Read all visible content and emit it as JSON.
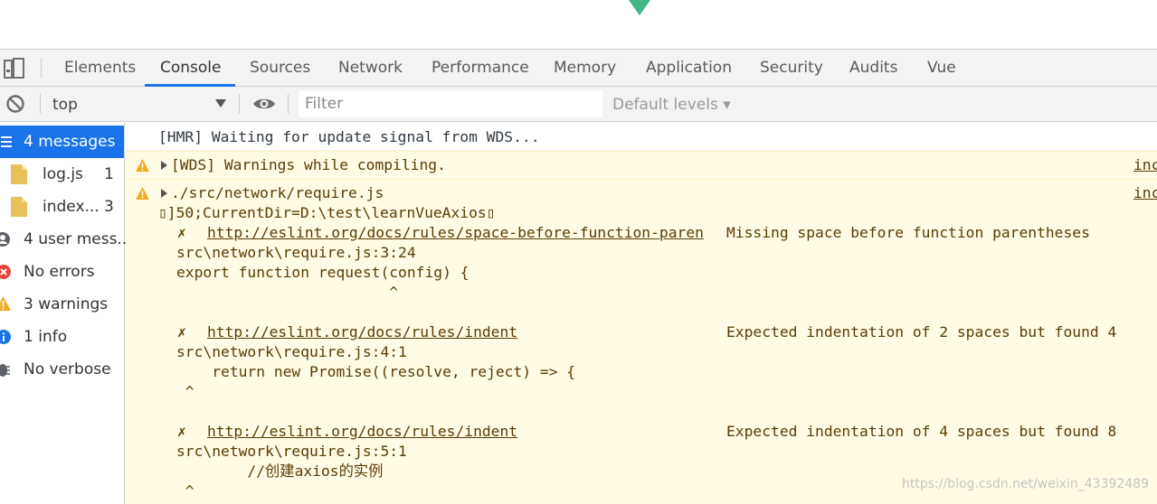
{
  "devtools": {
    "tabs": [
      "Elements",
      "Console",
      "Sources",
      "Network",
      "Performance",
      "Memory",
      "Application",
      "Security",
      "Audits",
      "Vue"
    ],
    "active_tab": "Console",
    "accent": "#1a73e8"
  },
  "toolbar": {
    "context": "top",
    "filter_placeholder": "Filter",
    "levels": "Default levels ▾"
  },
  "sidebar": {
    "messages": "4 messages",
    "files": [
      {
        "name": "log.js",
        "count": "1"
      },
      {
        "name": "index...",
        "count": "3"
      }
    ],
    "user_messages": "4 user mess...",
    "errors": "No errors",
    "warnings": "3 warnings",
    "info": "1 info",
    "verbose": "No verbose"
  },
  "console": {
    "hmr": "[HMR] Waiting for update signal from WDS...",
    "wds_warning": "[WDS] Warnings while compiling.",
    "source_link_1": "inc",
    "source_file": "./src/network/require.js",
    "source_link_2": "inc",
    "cwd": "▯]50;CurrentDir=D:\\test\\learnVueAxios▯",
    "issues": [
      {
        "mark": "✗",
        "rule_url": "http://eslint.org/docs/rules/space-before-function-paren",
        "message": "Missing space before function parentheses",
        "location": "src\\network\\require.js:3:24",
        "code": "export function request(config) {",
        "caret": "                        ^"
      },
      {
        "mark": "✗",
        "rule_url": "http://eslint.org/docs/rules/indent",
        "message": "Expected indentation of 2 spaces but found 4",
        "location": "src\\network\\require.js:4:1",
        "code": "    return new Promise((resolve, reject) => {",
        "caret": " ^"
      },
      {
        "mark": "✗",
        "rule_url": "http://eslint.org/docs/rules/indent",
        "message": "Expected indentation of 4 spaces but found 8",
        "location": "src\\network\\require.js:5:1",
        "code": "        //创建axios的实例",
        "caret": " ^"
      }
    ]
  },
  "watermark": "https://blog.csdn.net/weixin_43392489",
  "colors": {
    "warning_bg": "#fffbe5",
    "warning_text": "#5c3c00",
    "warning_icon": "#f2ab26",
    "error_icon": "#e8453c",
    "info_icon": "#1a73e8",
    "vue_green": "#41b883"
  }
}
